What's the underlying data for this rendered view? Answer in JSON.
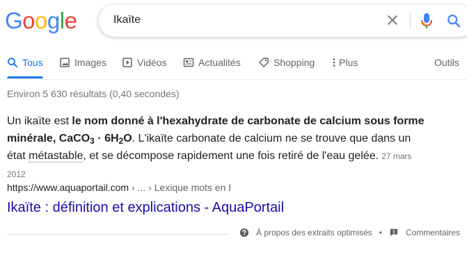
{
  "logo": {
    "text": "Google",
    "letters": [
      {
        "ch": "G",
        "color": "#4285F4"
      },
      {
        "ch": "o",
        "color": "#EA4335"
      },
      {
        "ch": "o",
        "color": "#FBBC05"
      },
      {
        "ch": "g",
        "color": "#4285F4"
      },
      {
        "ch": "l",
        "color": "#34A853"
      },
      {
        "ch": "e",
        "color": "#EA4335"
      }
    ]
  },
  "search": {
    "query": "Ikaïte",
    "icons": [
      "close-icon",
      "mic-icon",
      "search-icon"
    ]
  },
  "tabs": [
    {
      "label": "Tous",
      "icon": "search-icon",
      "active": true
    },
    {
      "label": "Images",
      "icon": "image-icon"
    },
    {
      "label": "Vidéos",
      "icon": "play-icon"
    },
    {
      "label": "Actualités",
      "icon": "news-icon"
    },
    {
      "label": "Shopping",
      "icon": "tag-icon"
    },
    {
      "label": "Plus",
      "icon": "more-vert-icon"
    },
    {
      "label": "Outils"
    }
  ],
  "stats": "Environ 5 630 résultats (0,40 secondes)",
  "snippet": {
    "part1": "Un ikaïte est ",
    "bold1": "le nom donné à l'hexahydrate de carbonate de calcium sous forme minérale, CaCO",
    "sub1": "3",
    "bold2": " · 6H",
    "sub2": "2",
    "bold3": "O",
    "part2": ". L'ikaïte carbonate de calcium ne se trouve que dans un état ",
    "dotted": "métastable",
    "part3": ", et se décompose rapidement une fois retiré de l'eau gelée.",
    "date": "27 mars 2012"
  },
  "cite": {
    "url": "https://www.aquaportail.com",
    "breadcrumb": " › ... › Lexique mots en I"
  },
  "result_title": "Ikaïte : définition et explications - AquaPortail",
  "footer": {
    "about": "À propos des extraits optimisés",
    "bullet": "•",
    "feedback": "Commentaires"
  },
  "colors": {
    "link": "#1a0dab",
    "accent": "#1a73e8",
    "muted": "#70757a"
  }
}
